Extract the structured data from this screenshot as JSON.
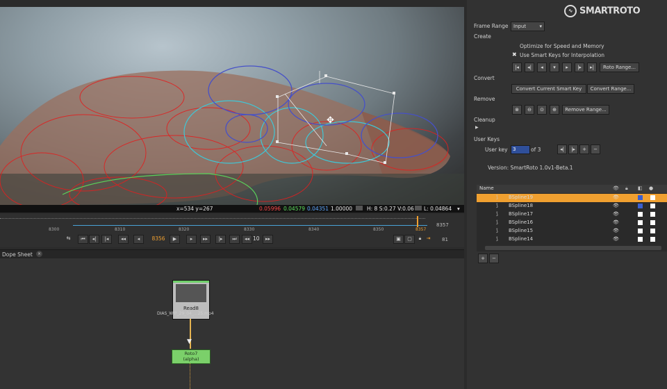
{
  "viewer": {
    "coords": "x=534 y=267",
    "r": "0.05996",
    "g": "0.04579",
    "b": "0.04351",
    "a": "1.00000",
    "hsv": "H: 8 S:0.27 V:0.06",
    "lum": "L: 0.04864"
  },
  "timeline": {
    "ticks": [
      "8300",
      "8310",
      "8320",
      "8330",
      "8340",
      "8350",
      "8357"
    ],
    "end_frame": "8357",
    "current_frame": "8356",
    "increment": "10",
    "fps": "81"
  },
  "dope_sheet": {
    "tab": "Dope Sheet"
  },
  "nodes": {
    "read": {
      "title": "Read8",
      "file": "DIAS_WIP_29_04_...25.mp4"
    },
    "roto": {
      "title": "Roto7",
      "channel": "(alpha)"
    }
  },
  "panel": {
    "logo": "SMARTROTO",
    "frame_range_label": "Frame Range",
    "frame_range_value": "Input",
    "create_label": "Create",
    "optimize_label": "Optimize for Speed and Memory",
    "smart_keys_label": "Use Smart Keys for Interpolation",
    "roto_range": "Roto Range...",
    "convert_label": "Convert",
    "convert_current": "Convert Current Smart Key",
    "convert_range": "Convert Range...",
    "remove_label": "Remove",
    "remove_range": "Remove Range...",
    "cleanup_label": "Cleanup",
    "user_keys_label": "User Keys",
    "user_key_label": "User key",
    "user_key_value": "3",
    "of_label": "of 3",
    "version": "Version:  SmartRoto 1.0v1-Beta.1"
  },
  "layers": {
    "header": "Name",
    "rows": [
      {
        "name": "BSpline19",
        "selected": true
      },
      {
        "name": "BSpline18",
        "selected": false
      },
      {
        "name": "BSpline17",
        "selected": false
      },
      {
        "name": "BSpline16",
        "selected": false
      },
      {
        "name": "BSpline15",
        "selected": false
      },
      {
        "name": "BSpline14",
        "selected": false
      }
    ]
  },
  "colors": {
    "selection": "#f0a030",
    "accent_blue": "#3a5fd0",
    "node_green": "#7bd06a"
  }
}
